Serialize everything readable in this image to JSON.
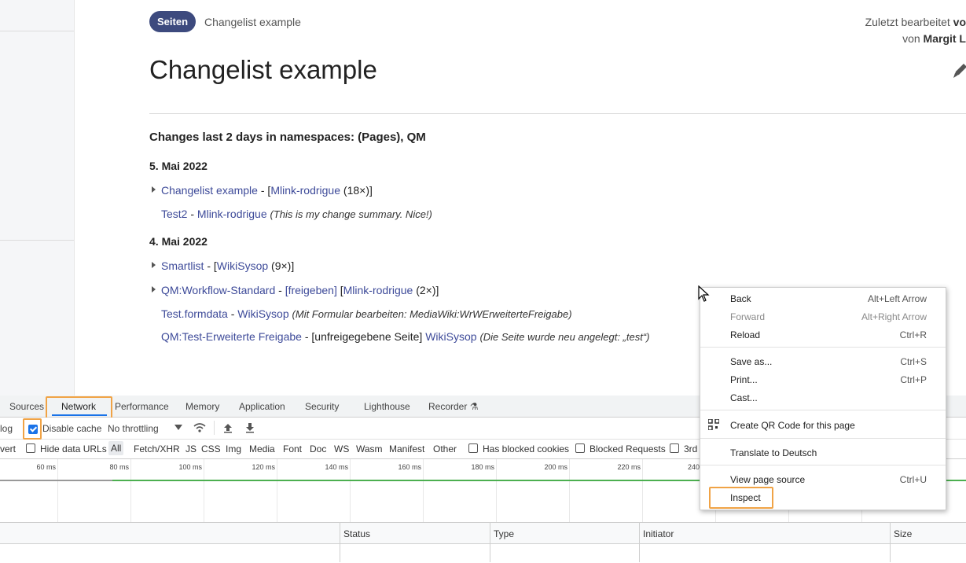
{
  "page": {
    "badge": "Seiten",
    "breadcrumb": "Changelist example",
    "edited_prefix": "Zuletzt bearbeitet",
    "edited_suffix": "vo",
    "edited_by_prefix": "von",
    "edited_by": "Margit L",
    "title": "Changelist example",
    "heading": "Changes last 2 days in namespaces: (Pages), QM",
    "groups": [
      {
        "date": "5. Mai 2022",
        "rows": [
          {
            "page": "Changelist example",
            "sep": " - ",
            "bracket_open": "[",
            "user": "Mlink-rodrigue",
            "count": " (18×)",
            "bracket_close": "]"
          },
          {
            "page": "Test2",
            "sep": " - ",
            "user": "Mlink-rodrigue",
            "summary": "(This is my change summary. Nice!)"
          }
        ]
      },
      {
        "date": "4. Mai 2022",
        "rows": [
          {
            "page": "Smartlist",
            "sep": " - ",
            "bracket_open": "[",
            "user": "WikiSysop",
            "count": " (9×)",
            "bracket_close": "]"
          },
          {
            "page": "QM:Workflow-Standard",
            "sep": " - ",
            "tag_link": "[freigeben]",
            "bracket_open": "[",
            "user": "Mlink-rodrigue",
            "count": " (2×)",
            "bracket_close": "]"
          },
          {
            "page": "Test.formdata",
            "sep": " - ",
            "user": "WikiSysop",
            "summary": "(Mit Formular bearbeiten: MediaWiki:WrWErweiterteFreigabe)"
          },
          {
            "page": "QM:Test-Erweiterte Freigabe",
            "sep": " - ",
            "tag_text": "[unfreigegebene Seite]",
            "user": "WikiSysop",
            "summary": "(Die Seite wurde neu angelegt: „test“)"
          }
        ]
      }
    ]
  },
  "devtools": {
    "tabs": [
      "Sources",
      "Network",
      "Performance",
      "Memory",
      "Application",
      "Security",
      "Lighthouse",
      "Recorder"
    ],
    "active_tab": "Network",
    "toolbar": {
      "preserve_log_fragment": "log",
      "disable_cache": "Disable cache",
      "throttling": "No throttling"
    },
    "filters": {
      "invert_fragment": "vert",
      "hide_data_urls": "Hide data URLs",
      "types": [
        "All",
        "Fetch/XHR",
        "JS",
        "CSS",
        "Img",
        "Media",
        "Font",
        "Doc",
        "WS",
        "Wasm",
        "Manifest",
        "Other"
      ],
      "has_blocked_cookies": "Has blocked cookies",
      "blocked_requests": "Blocked Requests",
      "third_party_fragment": "3rd"
    },
    "timeline_ticks": [
      "60 ms",
      "80 ms",
      "100 ms",
      "120 ms",
      "140 ms",
      "160 ms",
      "180 ms",
      "200 ms",
      "220 ms",
      "240"
    ],
    "columns": [
      "Status",
      "Type",
      "Initiator",
      "Size"
    ]
  },
  "context_menu": {
    "items": [
      {
        "label": "Back",
        "shortcut": "Alt+Left Arrow"
      },
      {
        "label": "Forward",
        "shortcut": "Alt+Right Arrow",
        "disabled": true
      },
      {
        "label": "Reload",
        "shortcut": "Ctrl+R"
      },
      {
        "label": "Save as...",
        "shortcut": "Ctrl+S"
      },
      {
        "label": "Print...",
        "shortcut": "Ctrl+P"
      },
      {
        "label": "Cast...",
        "shortcut": ""
      },
      {
        "label": "Create QR Code for this page",
        "shortcut": ""
      },
      {
        "label": "Translate to Deutsch",
        "shortcut": ""
      },
      {
        "label": "View page source",
        "shortcut": "Ctrl+U"
      },
      {
        "label": "Inspect",
        "shortcut": ""
      }
    ]
  },
  "colors": {
    "accent": "#3d4a7e",
    "link": "#3d4a99",
    "highlight": "#f0a346",
    "devtools_blue": "#1a73e8"
  }
}
